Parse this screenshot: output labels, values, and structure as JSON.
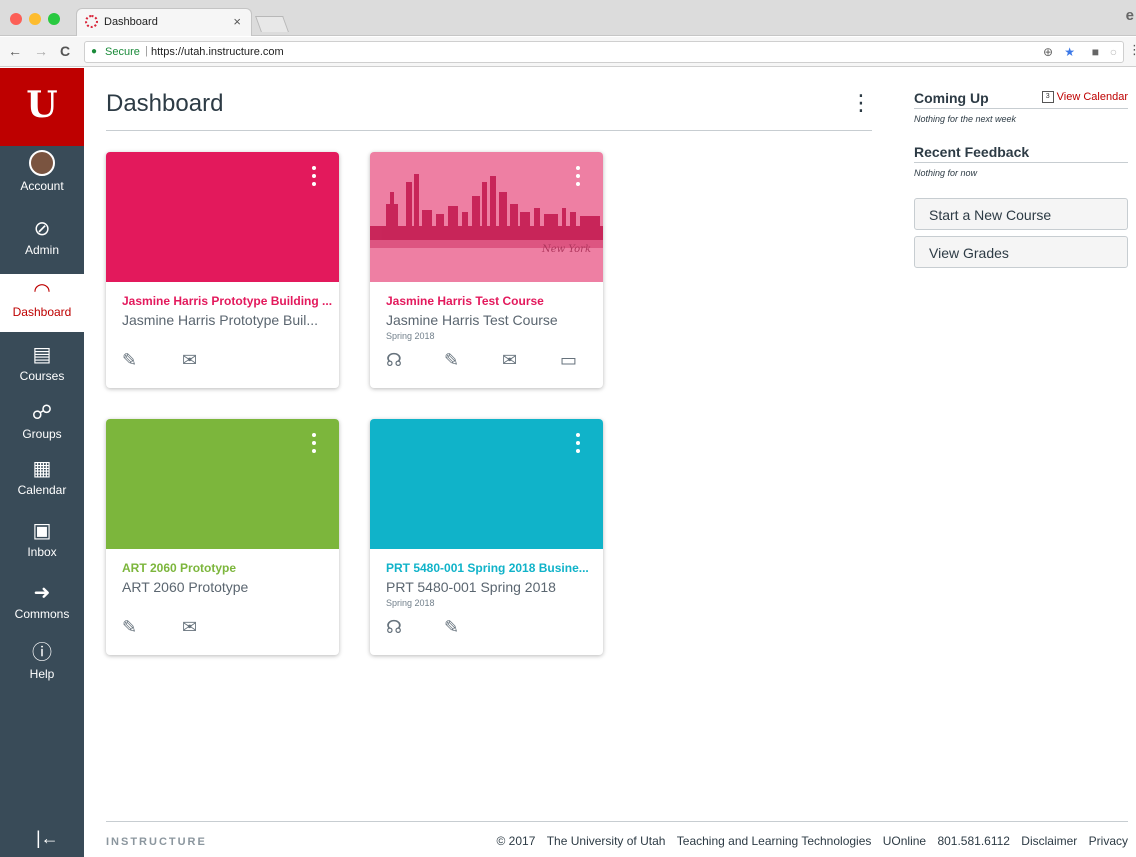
{
  "browser": {
    "tab_title": "Dashboard",
    "tab_close": "×",
    "profile_letter": "e",
    "secure_label": "Secure",
    "url": "https://utah.instructure.com",
    "nav_back": "←",
    "nav_forward": "→",
    "nav_reload": "C"
  },
  "global_nav": {
    "brand_letter": "U",
    "items": [
      {
        "label": "Account",
        "icon": "avatar-icon"
      },
      {
        "label": "Admin",
        "icon": "shield-icon"
      },
      {
        "label": "Dashboard",
        "icon": "dashboard-icon",
        "active": true
      },
      {
        "label": "Courses",
        "icon": "book-icon"
      },
      {
        "label": "Groups",
        "icon": "groups-icon"
      },
      {
        "label": "Calendar",
        "icon": "calendar-icon"
      },
      {
        "label": "Inbox",
        "icon": "inbox-icon"
      },
      {
        "label": "Commons",
        "icon": "commons-icon"
      },
      {
        "label": "Help",
        "icon": "help-icon"
      }
    ],
    "collapse_glyph": "|←"
  },
  "main": {
    "title": "Dashboard",
    "menu_glyph": "⋮"
  },
  "cards": [
    {
      "name": "Jasmine Harris Prototype Building ...",
      "code": "Jasmine Harris Prototype Buil...",
      "term": "",
      "color": "#e3195c",
      "icons": [
        "assignments-icon",
        "discussions-icon"
      ]
    },
    {
      "name": "Jasmine Harris Test Course",
      "code": "Jasmine Harris Test Course",
      "term": "Spring 2018",
      "color": "#e3195c",
      "image_caption": "New York",
      "icons": [
        "announcements-icon",
        "assignments-icon",
        "discussions-icon",
        "files-icon"
      ]
    },
    {
      "name": "ART 2060 Prototype",
      "code": "ART 2060 Prototype",
      "term": "",
      "color": "#7cb63c",
      "icons": [
        "assignments-icon",
        "discussions-icon"
      ]
    },
    {
      "name": "PRT 5480-001 Spring 2018 Busine...",
      "code": "PRT 5480-001 Spring 2018",
      "term": "Spring 2018",
      "color": "#10b3c9",
      "icons": [
        "announcements-icon",
        "assignments-icon"
      ]
    }
  ],
  "sidebar": {
    "coming_up_title": "Coming Up",
    "coming_up_empty": "Nothing for the next week",
    "view_calendar": "View Calendar",
    "calendar_day": "3",
    "recent_feedback_title": "Recent Feedback",
    "recent_feedback_empty": "Nothing for now",
    "start_course_button": "Start a New Course",
    "view_grades_button": "View Grades"
  },
  "footer": {
    "logo": "INSTRUCTURE",
    "copyright": "© 2017",
    "links": [
      "The University of Utah",
      "Teaching and Learning Technologies",
      "UOnline",
      "801.581.6112",
      "Disclaimer",
      "Privacy"
    ]
  },
  "colors": {
    "brand_red": "#be0000",
    "nav_bg": "#394b58",
    "text": "#2d3b45"
  }
}
